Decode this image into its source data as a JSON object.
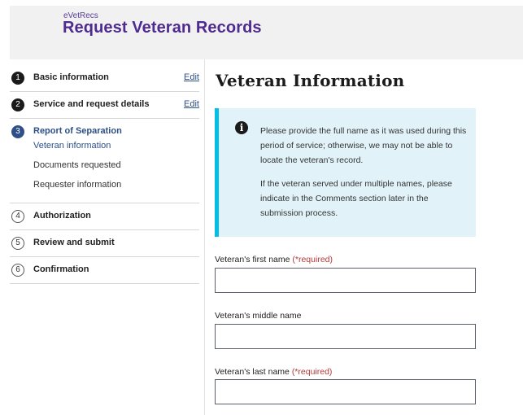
{
  "header": {
    "brand_small": "eVetRecs",
    "title": "Request Veteran Records"
  },
  "steps": [
    {
      "number": "1",
      "title": "Basic information",
      "edit": "Edit"
    },
    {
      "number": "2",
      "title": "Service and request details",
      "edit": "Edit"
    },
    {
      "number": "3",
      "title": "Report of Separation",
      "subitems": [
        "Veteran information",
        "Documents requested",
        "Requester information"
      ]
    },
    {
      "number": "4",
      "title": "Authorization"
    },
    {
      "number": "5",
      "title": "Review and submit"
    },
    {
      "number": "6",
      "title": "Confirmation"
    }
  ],
  "main": {
    "title": "Veteran Information",
    "alert": {
      "icon": "info-icon",
      "paragraph1": "Please provide the full name as it was used during this period of service; otherwise, we may not be able to locate the veteran's record.",
      "paragraph2": "If the veteran served under multiple names, please indicate in the Comments section later in the submission process."
    },
    "fields": [
      {
        "label": "Veteran's first name",
        "required_text": "(*required)",
        "value": ""
      },
      {
        "label": "Veteran's middle name",
        "value": ""
      },
      {
        "label": "Veteran's last name",
        "required_text": "(*required)",
        "value": ""
      }
    ]
  },
  "colors": {
    "brand": "#4f2a8f",
    "current_step": "#2e4f87",
    "alert_bg": "#e1f3f8",
    "alert_border": "#02bfe7",
    "required": "#b33a3a"
  }
}
